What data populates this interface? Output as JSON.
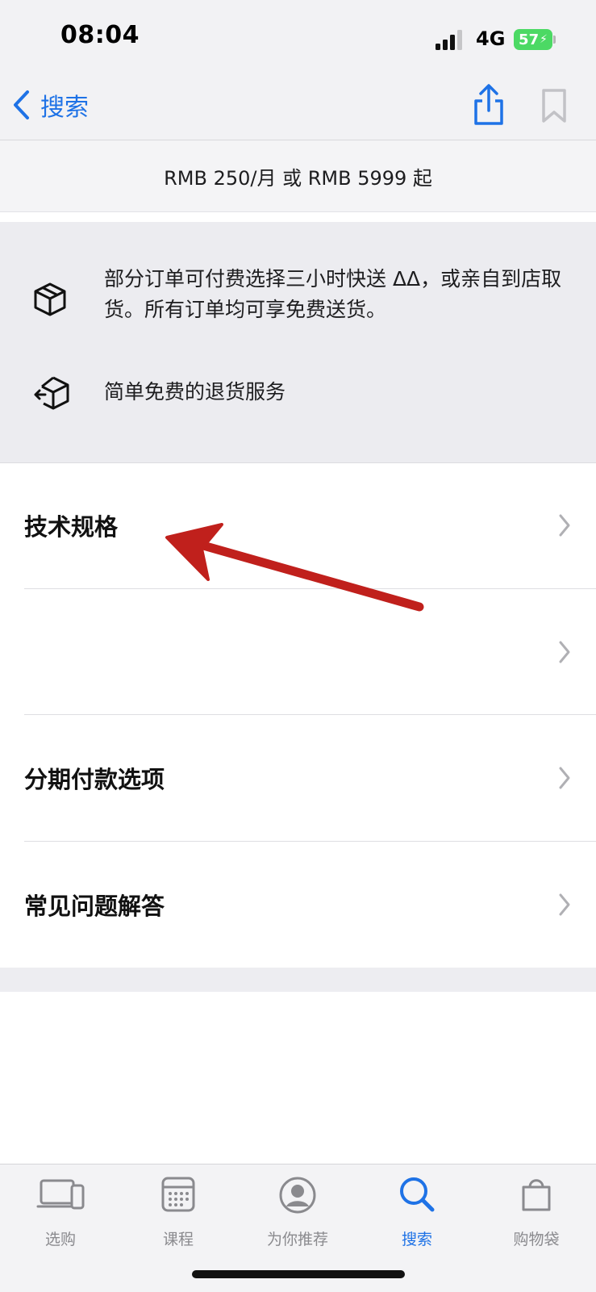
{
  "status_bar": {
    "time": "08:04",
    "network": "4G",
    "battery": "57"
  },
  "nav": {
    "back_label": "搜索",
    "back_icon": "chevron-left-icon",
    "share_icon": "share-icon",
    "bookmark_icon": "bookmark-icon"
  },
  "price_line": "RMB 250/月 或 RMB 5999 起",
  "delivery": {
    "items": [
      {
        "icon": "box-icon",
        "text": "部分订单可付费选择三小时快送 ΔΔ，或亲自到店取货。所有订单均可享免费送货。"
      },
      {
        "icon": "return-box-icon",
        "text": "简单免费的退货服务"
      }
    ]
  },
  "list": {
    "items": [
      {
        "label": "技术规格"
      },
      {
        "label": ""
      },
      {
        "label": "分期付款选项"
      },
      {
        "label": "常见问题解答"
      }
    ]
  },
  "tabs": [
    {
      "label": "选购",
      "icon": "devices-icon",
      "active": false
    },
    {
      "label": "课程",
      "icon": "calendar-icon",
      "active": false
    },
    {
      "label": "为你推荐",
      "icon": "profile-icon",
      "active": false
    },
    {
      "label": "搜索",
      "icon": "search-icon",
      "active": true
    },
    {
      "label": "购物袋",
      "icon": "bag-icon",
      "active": false
    }
  ],
  "colors": {
    "accent": "#1e72e6",
    "annotation_arrow": "#c0201c",
    "battery": "#4cd964"
  }
}
